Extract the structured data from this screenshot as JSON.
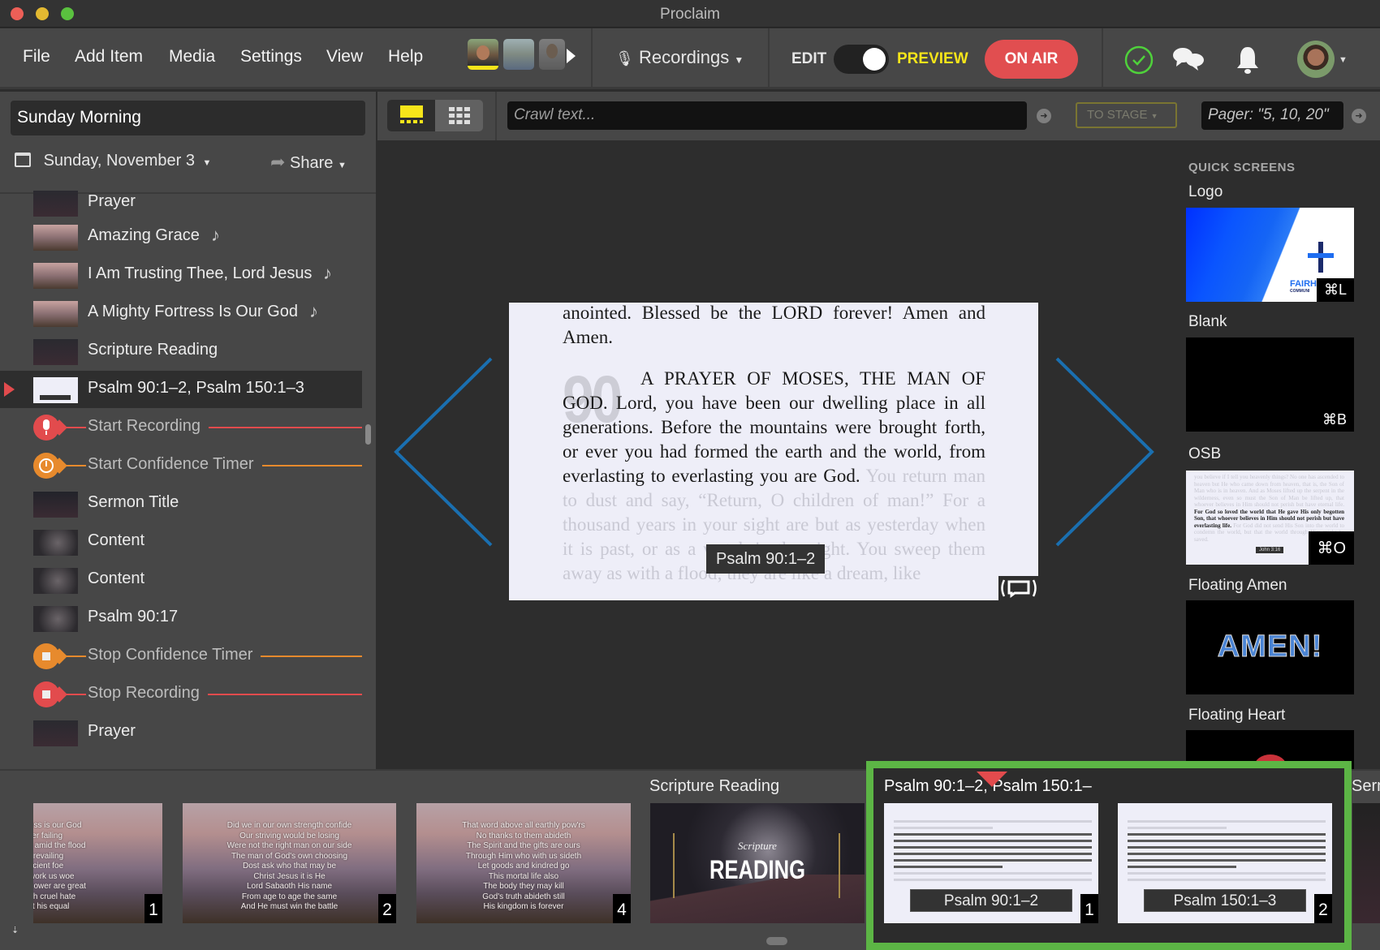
{
  "window": {
    "title": "Proclaim",
    "traffic_lights": {
      "close": "#ed5f57",
      "minimize": "#e3b931",
      "zoom": "#5ac13f"
    }
  },
  "menubar": {
    "items": [
      "File",
      "Add Item",
      "Media",
      "Settings",
      "View",
      "Help"
    ],
    "cameras": [
      {
        "name": "camera-1",
        "active": true
      },
      {
        "name": "camera-2",
        "active": false
      },
      {
        "name": "camera-3",
        "active": false
      }
    ],
    "recordings_label": "Recordings",
    "edit_label": "EDIT",
    "preview_label": "PREVIEW",
    "on_air_label": "ON AIR",
    "mode": "preview",
    "status": "connected"
  },
  "sidebar": {
    "service_name": "Sunday Morning",
    "date": "Sunday, November 3",
    "share_label": "Share",
    "items": [
      {
        "type": "item",
        "label": "Prayer",
        "thumb": "prayer",
        "music": false
      },
      {
        "type": "item",
        "label": "Amazing Grace",
        "thumb": "song",
        "music": true
      },
      {
        "type": "item",
        "label": "I Am Trusting Thee, Lord Jesus",
        "thumb": "song",
        "music": true
      },
      {
        "type": "item",
        "label": "A Mighty Fortress Is Our God",
        "thumb": "song",
        "music": true
      },
      {
        "type": "item",
        "label": "Scripture Reading",
        "thumb": "reading",
        "music": false
      },
      {
        "type": "item",
        "label": "Psalm 90:1–2, Psalm 150:1–3",
        "thumb": "bible",
        "music": false,
        "selected": true
      },
      {
        "type": "cue",
        "label": "Start Recording",
        "icon": "microphone",
        "color": "#e24b4d"
      },
      {
        "type": "cue",
        "label": "Start Confidence Timer",
        "icon": "clock",
        "color": "#e78a2d"
      },
      {
        "type": "item",
        "label": "Sermon Title",
        "thumb": "sermon",
        "music": false
      },
      {
        "type": "item",
        "label": "Content",
        "thumb": "content",
        "music": false
      },
      {
        "type": "item",
        "label": "Content",
        "thumb": "content",
        "music": false
      },
      {
        "type": "item",
        "label": "Psalm 90:17",
        "thumb": "content",
        "music": false
      },
      {
        "type": "cue",
        "label": "Stop Confidence Timer",
        "icon": "stop",
        "color": "#e78a2d"
      },
      {
        "type": "cue",
        "label": "Stop Recording",
        "icon": "stop",
        "color": "#e24b4d"
      },
      {
        "type": "item",
        "label": "Prayer",
        "thumb": "prayer",
        "music": false
      }
    ]
  },
  "toolbar": {
    "crawl_placeholder": "Crawl text...",
    "to_stage_label": "TO STAGE",
    "pager_placeholder": "Pager: \"5, 10, 20\""
  },
  "preview": {
    "chapter": "90",
    "before_text": "anointed. Blessed be the LORD forever! Amen and Amen.",
    "highlight_text": "A PRAYER OF MOSES, THE MAN OF GOD. Lord, you have been our dwelling place in all generations. Before the mountains were brought forth, or ever you had formed the earth and the world, from everlasting to everlasting you are God.",
    "after_text": "You return man to dust and say, “Return, O children of man!” For a thousand years in your sight are but as yesterday when it is past, or as a watch in the night. You sweep them away as with a flood; they are like a dream, like",
    "reference": "Psalm 90:1–2"
  },
  "quick_screens": {
    "title": "QUICK SCREENS",
    "items": [
      {
        "label": "Logo",
        "shortcut": "⌘L",
        "logo_text": "FAIRH",
        "logo_sub": "COMMUNI"
      },
      {
        "label": "Blank",
        "shortcut": "⌘B"
      },
      {
        "label": "OSB",
        "shortcut": "⌘O",
        "highlight": "For God so loved the world that He gave His only begotten Son, that whoever believes in Him should not perish but have everlasting life.",
        "reference": "John 3:16"
      },
      {
        "label": "Floating Amen",
        "text": "AMEN!"
      },
      {
        "label": "Floating Heart"
      }
    ]
  },
  "slide_strip": {
    "song_slides": [
      {
        "number": "1",
        "lines": [
          "A mighty fortress is our God",
          "A bulwark never failing",
          "Our helper He amid the flood",
          "Of mortal ills prevailing",
          "For still our ancient foe",
          "Doth seek to work us woe",
          "His craft and power are great",
          "And armed with cruel hate",
          "On earth is not his equal"
        ]
      },
      {
        "number": "2",
        "lines": [
          "Did we in our own strength confide",
          "Our striving would be losing",
          "Were not the right man on our side",
          "The man of God's own choosing",
          "Dost ask who that may be",
          "Christ Jesus it is He",
          "Lord Sabaoth His name",
          "From age to age the same",
          "And He must win the battle"
        ]
      },
      {
        "number": "4",
        "lines": [
          "That word above all earthly pow'rs",
          "No thanks to them abideth",
          "The Spirit and the gifts are ours",
          "Through Him who with us sideth",
          "Let goods and kindred go",
          "This mortal life also",
          "The body they may kill",
          "God's truth abideth still",
          "His kingdom is forever"
        ]
      }
    ],
    "scripture_group": {
      "label": "Scripture Reading",
      "title_small": "Scripture",
      "title_big": "READING"
    },
    "active_group": {
      "title": "Psalm 90:1–2, Psalm 150:1–",
      "slides": [
        {
          "number": "1",
          "reference": "Psalm 90:1–2"
        },
        {
          "number": "2",
          "reference": "Psalm 150:1–3"
        }
      ],
      "highlight_color": "#5cb545"
    },
    "next_group_label": "Serm"
  },
  "colors": {
    "accent_yellow": "#f6e51a",
    "on_air_red": "#e14e50",
    "arrow_blue": "#1a6fb0",
    "active_green": "#5cb545"
  }
}
